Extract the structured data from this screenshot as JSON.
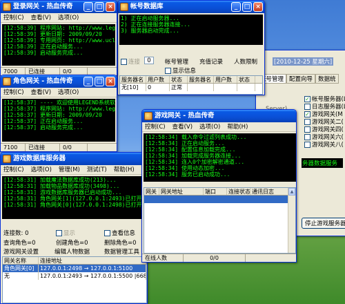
{
  "login": {
    "title": "登录网关 - 热血传奇",
    "menu": [
      "控制(C)",
      "查看(V)",
      "选项(O)"
    ],
    "log": [
      "[12:58:39] 程序网站: http://www.legend2.",
      "[12:58:39] 更新日期: 2009/09/20",
      "[12:58:39] 专用网页: http://www.ucl44.com",
      "[12:58:39] 正在启动服务...",
      "[12:58:39] 启动服务完成..."
    ],
    "status": [
      "7000",
      "已连接",
      "0/0"
    ]
  },
  "char": {
    "title": "角色网关 - 热血传奇",
    "menu": [
      "控制(C)",
      "查看(V)",
      "选项(O)"
    ],
    "log": [
      "[12:58:37] ---- 欢迎使用LEGEND系统软件----",
      "[12:58:37] 程序网站: http://www.legend2.",
      "[12:58:37] 更新日期: 2009/09/20",
      "[12:58:37] 正在启动服务...",
      "[12:58:37] 启动服务完成..."
    ],
    "status": [
      "7100",
      "已连接",
      "0/0"
    ]
  },
  "account": {
    "title": "帐号数据库",
    "log": [
      "1) 正在启动服务器...",
      "2) 正在连接服务器连接...",
      "3) 服务器启动完成..."
    ],
    "chk_connect": "连接",
    "port": "0",
    "tab_account": "帐号管理",
    "tab_recharge": "充值记录",
    "tab_count": "人数限制",
    "chk_show": "显示信息",
    "cols": [
      "服务器名",
      "用户数",
      "状态",
      "服务器名",
      "用户数",
      "状态"
    ],
    "rows": [
      [
        "无[10]",
        "0",
        "正常",
        "",
        "",
        ""
      ]
    ]
  },
  "right": {
    "date": "[2010-12-25 星期六]",
    "tabs": [
      "帐号管理",
      "配置向导",
      "数据统"
    ],
    "server_text": "Server)",
    "checks": [
      {
        "label": "帐号服务器(L",
        "on": true
      },
      {
        "label": "日志服务器(L",
        "on": false
      },
      {
        "label": "游戏网关(M",
        "on": true
      },
      {
        "label": "游戏网关二(",
        "on": false
      },
      {
        "label": "游戏网关四(",
        "on": false
      },
      {
        "label": "游戏网关六(",
        "on": false
      },
      {
        "label": "游戏网关八(",
        "on": false
      }
    ],
    "console_text": "务器数据服务",
    "stop_button": "停止游戏服务器"
  },
  "gate": {
    "title": "游戏网关 - 热血传奇",
    "menu": [
      "控制(C)",
      "查看(V)",
      "选项(O)",
      "帮助(H)"
    ],
    "log": [
      "[12:58:34] 载入命令过滤列表成功...",
      "[12:58:34] 正在启动服务...",
      "[12:58:34] 配置信息加载完成...",
      "[12:58:34] 加载完成服务器连接...",
      "[12:58:34] 连入0个加密解密通道...",
      "[12:58:34] 使用动态加密...",
      "[12:58:34] 服务已启动成功..."
    ],
    "cols": [
      "网关",
      "网关地址",
      "端口",
      "连接状态",
      "通讯日志"
    ],
    "status": [
      "在线人数",
      "0/0"
    ]
  },
  "db": {
    "title": "游戏数据库服务器",
    "menu": [
      "控制(C)",
      "选项(O)",
      "管理(M)",
      "测试(T)",
      "帮助(H)"
    ],
    "log": [
      "[12:58:31] 加载魔法数据库成功(213)...",
      "[12:58:31] 加载物品数据库成功(3498)...",
      "[12:58:31] 游戏数据库服务器已启动成功...",
      "[12:58:31] 角色网关[1](127.0.0.1:2493)已打开",
      "[12:58:31] 角色网关[0](127.0.0.1:2498)已打开"
    ],
    "conn_count": "连接数: 0",
    "chk_show": "显示",
    "chk_view": "查看信息",
    "query_chr": "查询角色=0",
    "create_chr": "创建角色=0",
    "del_chr": "删除角色=0",
    "btn_gateset": "游戏网关设置",
    "btn_editchr": "编辑人物数据",
    "btn_dbtool": "数据管理工具",
    "cols": [
      "网关名称",
      "连接地址"
    ],
    "rows": [
      [
        "角色网关[0]",
        "127.0.0.1:2498 → 127.0.0.1:5100"
      ],
      [
        "无",
        "127.0.0.1:2493 → 127.0.0.1:5500      |668/0/0"
      ]
    ]
  }
}
